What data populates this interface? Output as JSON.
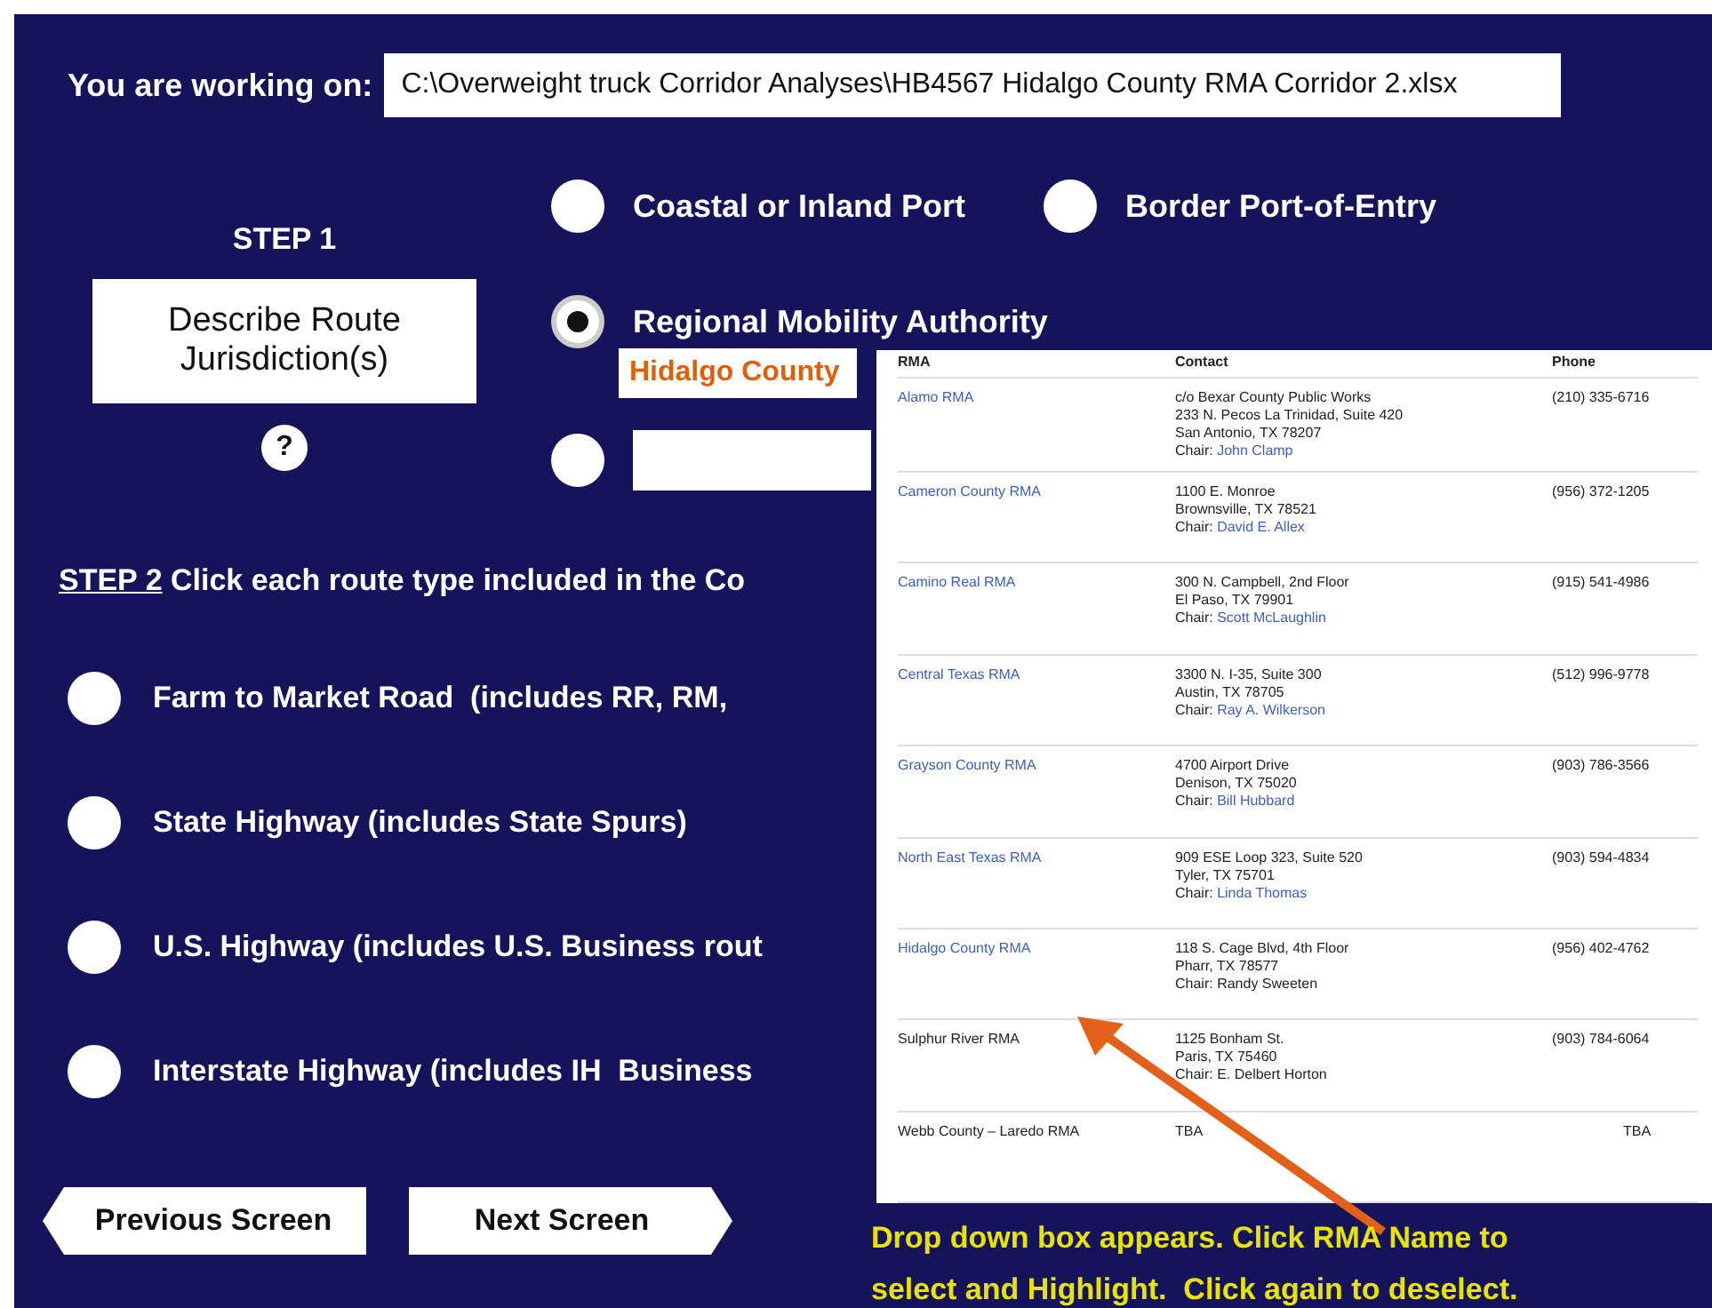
{
  "header": {
    "label": "You are working on:",
    "file_path": "C:\\Overweight truck Corridor Analyses\\HB4567 Hidalgo County RMA Corridor 2.xlsx"
  },
  "step1": {
    "title": "STEP 1",
    "button": "Describe Route Jurisdiction(s)",
    "help": "?",
    "options": [
      {
        "label": "Coastal or Inland Port",
        "selected": false
      },
      {
        "label": "Border Port-of-Entry",
        "selected": false
      },
      {
        "label": "Regional Mobility Authority",
        "selected": true,
        "value": "Hidalgo County"
      },
      {
        "selected": false
      }
    ]
  },
  "step2": {
    "title": "STEP 2",
    "instruction": "Click each route type included in the Co",
    "routes": [
      {
        "label": "Farm to Market Road  (includes RR, RM,",
        "selected": false
      },
      {
        "label": "State Highway (includes State Spurs)",
        "selected": false
      },
      {
        "label": "U.S. Highway (includes U.S. Business rout",
        "selected": false
      },
      {
        "label": "Interstate Highway (includes IH  Business",
        "selected": false
      }
    ]
  },
  "buttons": {
    "previous": "Previous Screen",
    "next": "Next Screen"
  },
  "rma_dropdown": {
    "columns": [
      "RMA",
      "Contact",
      "Phone"
    ],
    "rows": [
      {
        "name": "Alamo RMA",
        "link": true,
        "contact": [
          "c/o Bexar County Public Works",
          "233 N. Pecos La Trinidad, Suite 420",
          "San Antonio, TX 78207"
        ],
        "chair_label": "Chair:",
        "chair": "John Clamp",
        "chair_link": true,
        "phone": "(210) 335-6716"
      },
      {
        "name": "Cameron County RMA",
        "link": true,
        "contact": [
          "1100 E. Monroe",
          "Brownsville, TX 78521"
        ],
        "chair_label": "Chair:",
        "chair": "David E. Allex",
        "chair_link": true,
        "phone": "(956) 372-1205"
      },
      {
        "name": "Camino Real RMA",
        "link": true,
        "contact": [
          "300 N. Campbell, 2nd Floor",
          "El Paso, TX 79901"
        ],
        "chair_label": "Chair:",
        "chair": "Scott McLaughlin",
        "chair_link": true,
        "phone": "(915) 541-4986"
      },
      {
        "name": "Central Texas RMA",
        "link": true,
        "contact": [
          "3300 N. I-35, Suite 300",
          "Austin, TX 78705"
        ],
        "chair_label": "Chair:",
        "chair": "Ray A. Wilkerson",
        "chair_link": true,
        "phone": "(512) 996-9778"
      },
      {
        "name": "Grayson County RMA",
        "link": true,
        "contact": [
          "4700 Airport Drive",
          "Denison, TX 75020"
        ],
        "chair_label": "Chair:",
        "chair": "Bill Hubbard",
        "chair_link": true,
        "phone": "(903) 786-3566"
      },
      {
        "name": "North East Texas RMA",
        "link": true,
        "contact": [
          "909 ESE Loop 323, Suite 520",
          "Tyler, TX 75701"
        ],
        "chair_label": "Chair:",
        "chair": "Linda Thomas",
        "chair_link": true,
        "phone": "(903) 594-4834"
      },
      {
        "name": "Hidalgo County RMA",
        "link": true,
        "contact": [
          "118 S. Cage Blvd, 4th Floor",
          "Pharr, TX 78577"
        ],
        "chair_label": "Chair:",
        "chair": "Randy Sweeten",
        "chair_link": false,
        "phone": "(956) 402-4762"
      },
      {
        "name": "Sulphur River RMA",
        "link": false,
        "contact": [
          "1125 Bonham St.",
          "Paris, TX 75460"
        ],
        "chair_label": "Chair:",
        "chair": "E. Delbert Horton",
        "chair_link": false,
        "phone": "(903) 784-6064"
      },
      {
        "name": "Webb County – Laredo RMA",
        "link": false,
        "contact": [
          "TBA"
        ],
        "phone": "TBA"
      }
    ]
  },
  "callout": {
    "lines": [
      "Drop down box appears. Click RMA Name to",
      "select and Highlight.  Click again to deselect."
    ]
  }
}
